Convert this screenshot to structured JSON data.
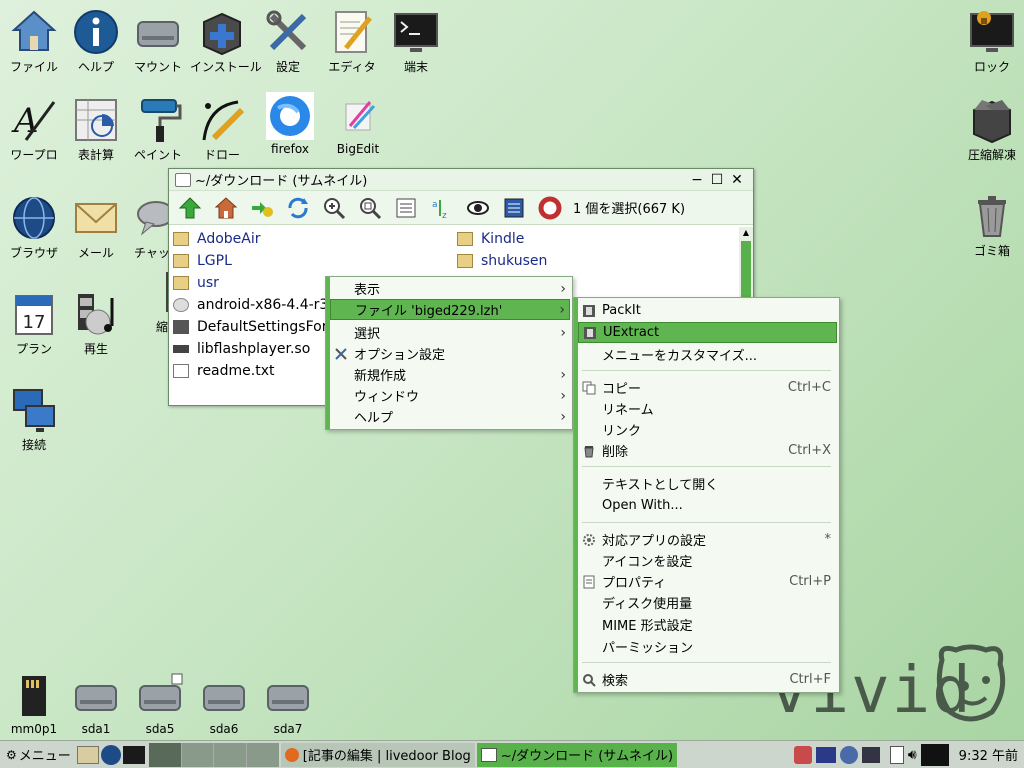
{
  "desktop": {
    "left_icons": [
      {
        "label": "ファイル",
        "icon": "home-folder-icon"
      },
      {
        "label": "ヘルプ",
        "icon": "help-icon"
      },
      {
        "label": "マウント",
        "icon": "drive-icon"
      },
      {
        "label": "インストール",
        "icon": "install-box-icon"
      },
      {
        "label": "設定",
        "icon": "tools-icon"
      },
      {
        "label": "エディタ",
        "icon": "editor-icon"
      },
      {
        "label": "端末",
        "icon": "terminal-icon"
      },
      {
        "label": "ワープロ",
        "icon": "wordprocessor-icon"
      },
      {
        "label": "表計算",
        "icon": "spreadsheet-icon"
      },
      {
        "label": "ペイント",
        "icon": "paint-roller-icon"
      },
      {
        "label": "ドロー",
        "icon": "draw-icon"
      },
      {
        "label": "firefox",
        "icon": "firefox-icon"
      },
      {
        "label": "BigEdit",
        "icon": "bigedit-icon"
      },
      {
        "label": "ブラウザ",
        "icon": "globe-icon"
      },
      {
        "label": "メール",
        "icon": "mail-icon"
      },
      {
        "label": "チャット",
        "icon": "chat-icon"
      },
      {
        "label": "プラン",
        "icon": "calendar-icon"
      },
      {
        "label": "再生",
        "icon": "media-icon"
      },
      {
        "label": "接続",
        "icon": "network-icon"
      },
      {
        "label": "縮",
        "icon": "partial-icon"
      }
    ],
    "right_icons": [
      {
        "label": "ロック",
        "icon": "lock-screen-icon"
      },
      {
        "label": "圧縮解凍",
        "icon": "archive-icon"
      },
      {
        "label": "ゴミ箱",
        "icon": "trash-icon"
      }
    ],
    "drive_icons": [
      {
        "label": "mm0p1",
        "icon": "sdcard-icon"
      },
      {
        "label": "sda1",
        "icon": "drive-icon"
      },
      {
        "label": "sda5",
        "icon": "drive-icon"
      },
      {
        "label": "sda6",
        "icon": "drive-icon"
      },
      {
        "label": "sda7",
        "icon": "drive-icon"
      }
    ],
    "calendar_day": "17",
    "brand": "vivid"
  },
  "window": {
    "title": "~/ダウンロード (サムネイル)",
    "status": "1 個を選択(667 K)",
    "files_col1": [
      "AdobeAir",
      "LGPL",
      "usr",
      "android-x86-4.4-r3.",
      "DefaultSettingsFor",
      "libflashplayer.so",
      "readme.txt"
    ],
    "files_col2": [
      "Kindle",
      "shukusen"
    ]
  },
  "context_menu": {
    "items": [
      "表示",
      "ファイル 'biged229.lzh'",
      "選択",
      "オプション設定",
      "新規作成",
      "ウィンドウ",
      "ヘルプ"
    ]
  },
  "submenu": {
    "items": [
      {
        "label": "PackIt",
        "accel": ""
      },
      {
        "label": "UExtract",
        "accel": ""
      },
      {
        "label": "メニューをカスタマイズ...",
        "accel": ""
      },
      {
        "label": "コピー",
        "accel": "Ctrl+C"
      },
      {
        "label": "リネーム",
        "accel": ""
      },
      {
        "label": "リンク",
        "accel": ""
      },
      {
        "label": "削除",
        "accel": "Ctrl+X"
      },
      {
        "label": "テキストとして開く",
        "accel": ""
      },
      {
        "label": "Open With...",
        "accel": ""
      },
      {
        "label": "対応アプリの設定",
        "accel": "*"
      },
      {
        "label": "アイコンを設定",
        "accel": ""
      },
      {
        "label": "プロパティ",
        "accel": "Ctrl+P"
      },
      {
        "label": "ディスク使用量",
        "accel": ""
      },
      {
        "label": "MIME 形式設定",
        "accel": ""
      },
      {
        "label": "パーミッション",
        "accel": ""
      },
      {
        "label": "検索",
        "accel": "Ctrl+F"
      }
    ]
  },
  "taskbar": {
    "menu": "メニュー",
    "task1": "[記事の編集 | livedoor Blog",
    "task2": "~/ダウンロード (サムネイル)",
    "clock": "9:32 午前"
  },
  "colors": {
    "accent": "#5fb550",
    "panel": "#ccd6cc"
  }
}
